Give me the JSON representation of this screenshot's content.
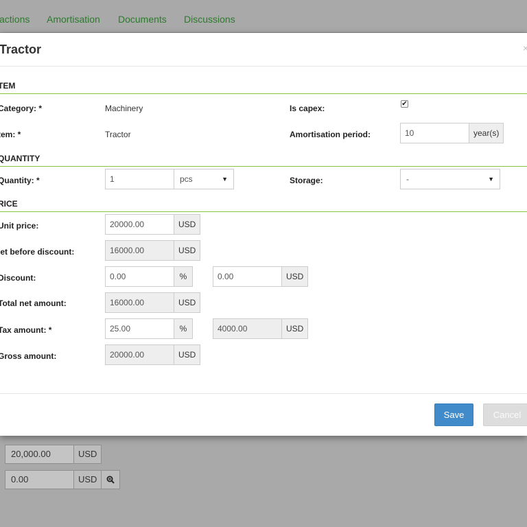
{
  "background": {
    "tabs": [
      "actions",
      "Amortisation",
      "Documents",
      "Discussions"
    ],
    "fields": [
      {
        "value": "20,000.00",
        "addon": "USD"
      },
      {
        "value": "0.00",
        "addon": "USD"
      }
    ]
  },
  "modal": {
    "title": "Tractor",
    "close": "×",
    "sections": {
      "item": "TEM",
      "quantity": "QUANTITY",
      "price": "RICE"
    },
    "category": {
      "label": "Category: *",
      "value": "Machinery"
    },
    "item": {
      "label": "tem: *",
      "value": "Tractor"
    },
    "is_capex": {
      "label": "Is capex:",
      "checked": true,
      "mark": "✔"
    },
    "amortisation_period": {
      "label": "Amortisation period:",
      "value": "10",
      "unit": "year(s)"
    },
    "quantity": {
      "label": "Quantity: *",
      "value": "1",
      "unit": "pcs"
    },
    "storage": {
      "label": "Storage:",
      "value": "-"
    },
    "unit_price": {
      "label": "Unit price:",
      "value": "20000.00",
      "currency": "USD"
    },
    "net_before_discount": {
      "label": "let before discount:",
      "value": "16000.00",
      "currency": "USD"
    },
    "discount": {
      "label": "Discount:",
      "percent_value": "0.00",
      "percent_unit": "%",
      "amount_value": "0.00",
      "currency": "USD"
    },
    "total_net_amount": {
      "label": "Total net amount:",
      "value": "16000.00",
      "currency": "USD"
    },
    "tax_amount": {
      "label": "Tax amount: *",
      "percent_value": "25.00",
      "percent_unit": "%",
      "amount_value": "4000.00",
      "currency": "USD"
    },
    "gross_amount": {
      "label": "Gross amount:",
      "value": "20000.00",
      "currency": "USD"
    }
  },
  "footer": {
    "save_label": "Save",
    "cancel_label": "Cancel"
  },
  "colors": {
    "accent": "#428bca",
    "section_rule": "#8cc63f",
    "tab_link": "#2c7a2c"
  }
}
